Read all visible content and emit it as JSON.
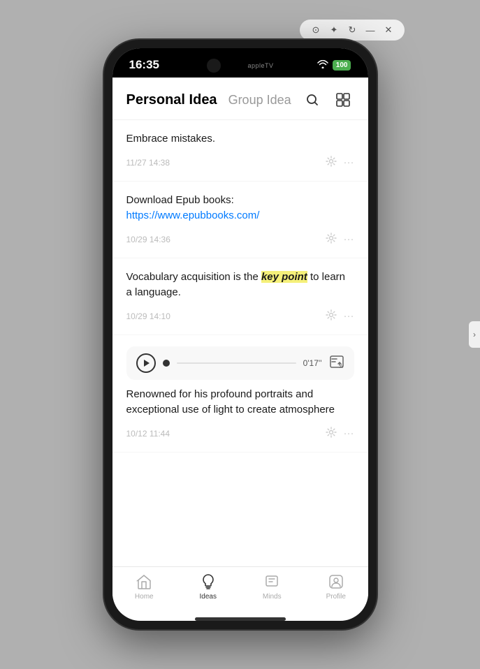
{
  "window": {
    "chrome_icons": [
      "circle-icon",
      "star-icon",
      "refresh-icon"
    ],
    "chrome_minimize": "—",
    "chrome_close": "✕"
  },
  "status_bar": {
    "time": "16:35",
    "app_label": "appleTV",
    "wifi": "WiFi",
    "battery": "100"
  },
  "header": {
    "tab_personal": "Personal Idea",
    "tab_group": "Group Idea",
    "search_label": "search",
    "layout_label": "layout"
  },
  "ideas": [
    {
      "id": "idea1",
      "text": "Embrace mistakes.",
      "timestamp": "11/27 14:38",
      "has_link": false,
      "has_audio": false,
      "has_highlight": false
    },
    {
      "id": "idea2",
      "text_before": "Download Epub books: ",
      "link_text": "https://www.epubbooks.com/",
      "text_after": "",
      "timestamp": "10/29 14:36",
      "has_link": true,
      "has_audio": false,
      "has_highlight": false
    },
    {
      "id": "idea3",
      "text_before": "Vocabulary acquisition is the ",
      "highlight_text": "key point",
      "text_after": " to learn a language.",
      "timestamp": "10/29 14:10",
      "has_link": false,
      "has_audio": false,
      "has_highlight": true
    },
    {
      "id": "idea4",
      "audio_duration": "0'17''",
      "text": "Renowned for his profound portraits and exceptional use of light to create atmosphere",
      "timestamp": "10/12 11:44",
      "has_link": false,
      "has_audio": true,
      "has_highlight": false
    }
  ],
  "tab_bar": {
    "home": "Home",
    "ideas": "Ideas",
    "minds": "Minds",
    "profile": "Profile"
  }
}
